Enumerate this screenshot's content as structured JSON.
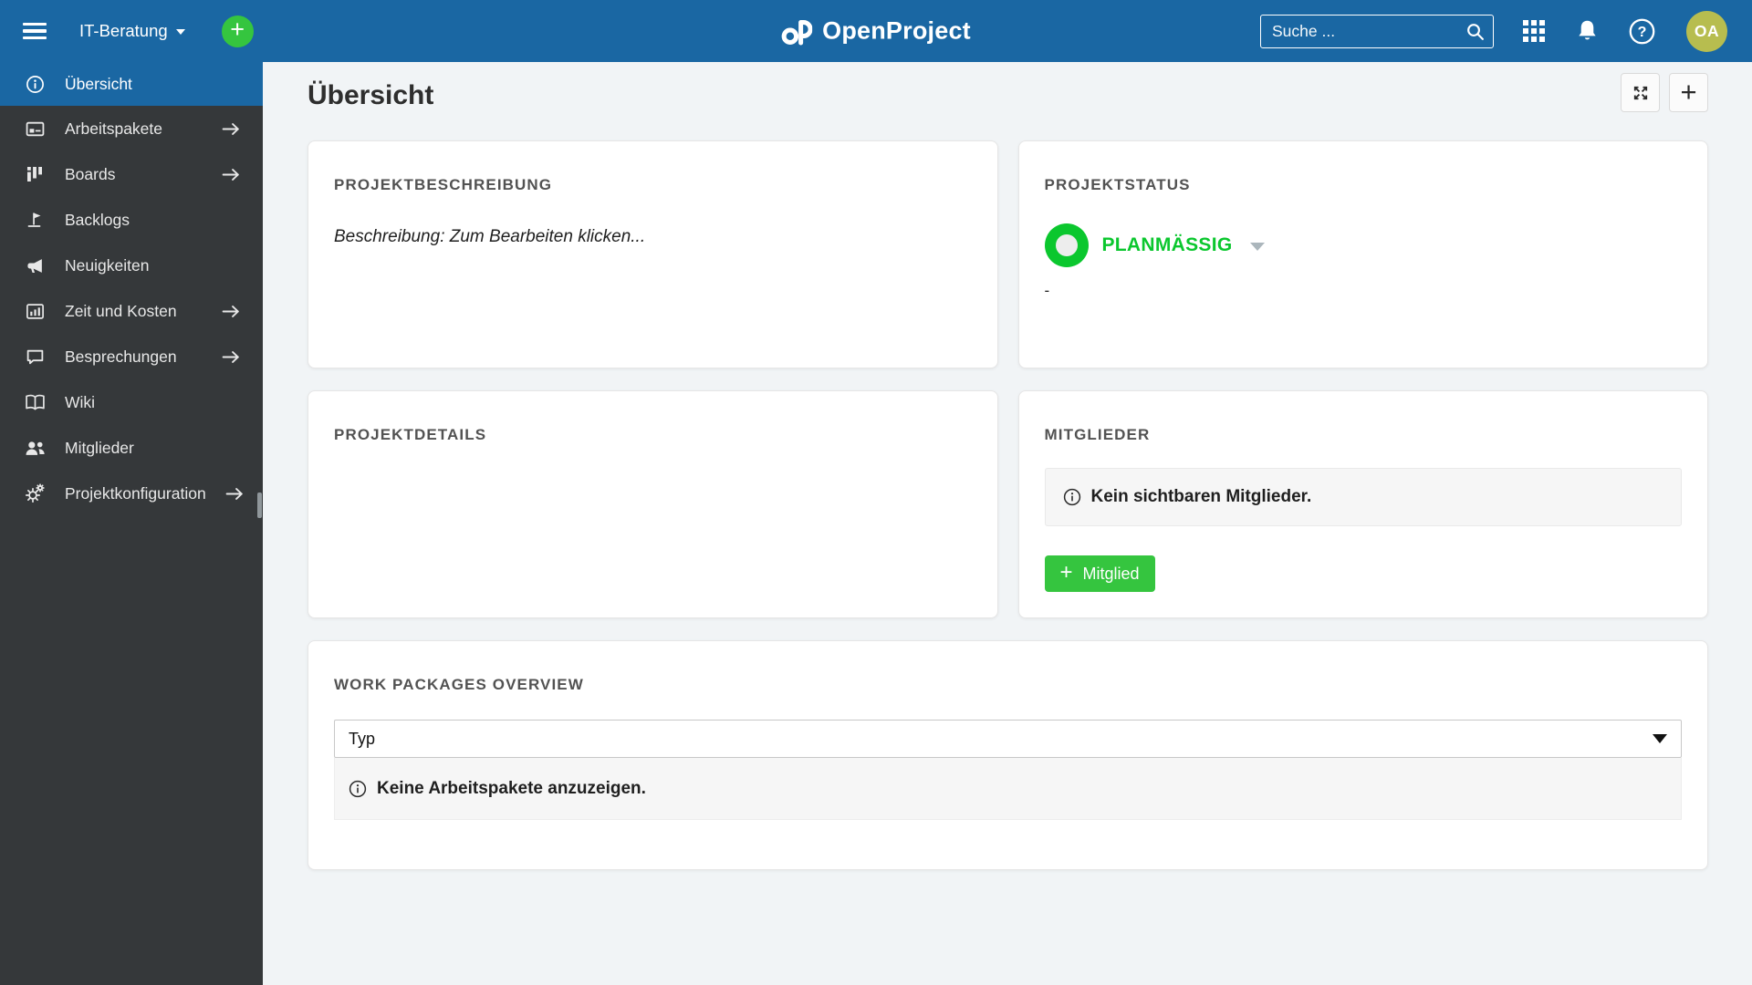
{
  "topbar": {
    "project_menu_label": "IT-Beratung",
    "logo_text": "OpenProject",
    "search_placeholder": "Suche ...",
    "avatar_initials": "OA"
  },
  "icons": {
    "plus_glyph": "+",
    "question_glyph": "?"
  },
  "sidebar": {
    "items": [
      {
        "label": "Übersicht",
        "icon": "info-icon",
        "active": true,
        "has_submenu": false
      },
      {
        "label": "Arbeitspakete",
        "icon": "work-packages-icon",
        "active": false,
        "has_submenu": true
      },
      {
        "label": "Boards",
        "icon": "boards-icon",
        "active": false,
        "has_submenu": true
      },
      {
        "label": "Backlogs",
        "icon": "backlogs-icon",
        "active": false,
        "has_submenu": false
      },
      {
        "label": "Neuigkeiten",
        "icon": "news-icon",
        "active": false,
        "has_submenu": false
      },
      {
        "label": "Zeit und Kosten",
        "icon": "time-and-costs-icon",
        "active": false,
        "has_submenu": true
      },
      {
        "label": "Besprechungen",
        "icon": "meetings-icon",
        "active": false,
        "has_submenu": true
      },
      {
        "label": "Wiki",
        "icon": "wiki-icon",
        "active": false,
        "has_submenu": false
      },
      {
        "label": "Mitglieder",
        "icon": "members-icon",
        "active": false,
        "has_submenu": false
      },
      {
        "label": "Projektkonfiguration",
        "icon": "settings-icon",
        "active": false,
        "has_submenu": true
      }
    ]
  },
  "page": {
    "title": "Übersicht"
  },
  "widgets": {
    "project_description": {
      "title": "PROJEKTBESCHREIBUNG",
      "placeholder_text": "Beschreibung: Zum Bearbeiten klicken..."
    },
    "project_status": {
      "title": "PROJEKTSTATUS",
      "status_label": "PLANMÄSSIG",
      "status_color": "#0BC72E",
      "description": "-"
    },
    "project_details": {
      "title": "PROJEKTDETAILS"
    },
    "members": {
      "title": "MITGLIEDER",
      "empty_message": "Kein sichtbaren Mitglieder.",
      "add_button_label": "Mitglied"
    },
    "work_packages": {
      "title": "WORK PACKAGES OVERVIEW",
      "group_by_value": "Typ",
      "empty_message": "Keine Arbeitspakete anzuzeigen."
    }
  },
  "colors": {
    "header_background": "#1A67A3",
    "sidebar_background": "#35383A",
    "status_green": "#0BC72E",
    "button_green": "#35C53F",
    "avatar_background": "#B7BD4F"
  }
}
